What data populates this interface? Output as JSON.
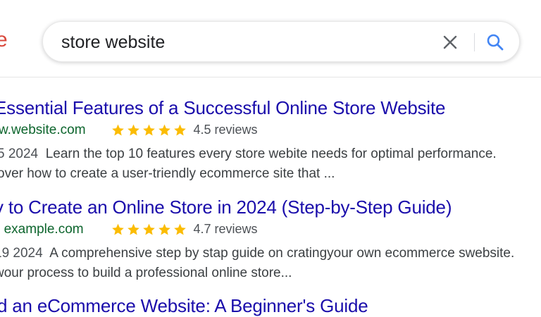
{
  "header": {
    "logo_fragment": "e",
    "search": {
      "query": "store website"
    }
  },
  "results": [
    {
      "title": "Essential Features of a Successful Online Store Website",
      "url": "w.website.com",
      "reviews": "4.5 reviews",
      "rating": 4.5,
      "date": "5  2024",
      "snippet_line1": "Learn the top 10 features every store webite needs for optimal performance.",
      "snippet_line2": "over how to create a user-triendly ecommerce site that ..."
    },
    {
      "title": "v to Create an Online Store in 2024 (Step-by-Step Guide)",
      "url": "example.com",
      "url_prefix": "›",
      "reviews": "4.7 reviews",
      "rating": 4.7,
      "date": "19  2024",
      "snippet_line1": "A comprehensive step by stap guide on cratingyour own ecommerce swebsite.",
      "snippet_line2": " wour process to build a professional online store..."
    },
    {
      "title": "d an eCommerce Website: A Beginner's Guide"
    }
  ],
  "colors": {
    "link": "#1a0dab",
    "url": "#0d652d",
    "star": "#fbbc04",
    "search_icon": "#4285f4"
  }
}
